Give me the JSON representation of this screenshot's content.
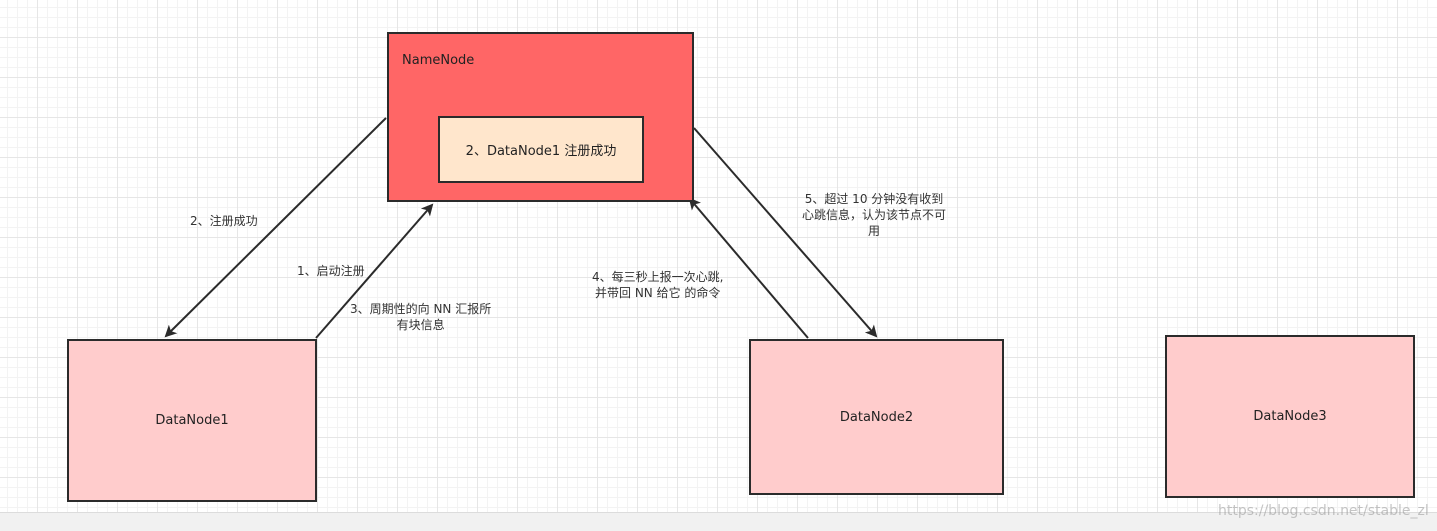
{
  "namenode": {
    "title": "NameNode",
    "inner_label": "2、DataNode1 注册成功"
  },
  "datanodes": {
    "dn1": "DataNode1",
    "dn2": "DataNode2",
    "dn3": "DataNode3"
  },
  "labels": {
    "register_success": "2、注册成功",
    "start_register": "1、启动注册",
    "report_blocks_line1": "3、周期性的向 NN 汇报所",
    "report_blocks_line2": "有块信息",
    "heartbeat_line1": "4、每三秒上报一次心跳,",
    "heartbeat_line2": "并带回 NN 给它 的命令",
    "timeout_line1": "5、超过 10 分钟没有收到",
    "timeout_line2": "心跳信息，认为该节点不可",
    "timeout_line3": "用"
  },
  "watermark": "https://blog.csdn.net/stable_zl",
  "colors": {
    "namenode_fill": "#ff6666",
    "inner_fill": "#ffe6cc",
    "datanode_fill": "#ffcccc",
    "stroke": "#2b2b2b"
  }
}
